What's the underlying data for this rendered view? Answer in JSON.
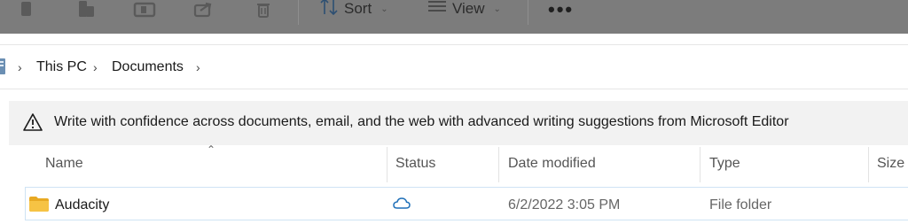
{
  "toolbar": {
    "sort_label": "Sort",
    "view_label": "View",
    "more_label": "•••"
  },
  "breadcrumb": {
    "items": [
      "This PC",
      "Documents"
    ]
  },
  "banner": {
    "text": "Write with confidence across documents, email, and the web with advanced writing suggestions from Microsoft Editor"
  },
  "columns": {
    "name": "Name",
    "status": "Status",
    "date_modified": "Date modified",
    "type": "Type",
    "size": "Size"
  },
  "rows": [
    {
      "name": "Audacity",
      "status_icon": "cloud-icon",
      "date_modified": "6/2/2022 3:05 PM",
      "type": "File folder"
    }
  ],
  "colors": {
    "toolbar_overlay": "#7c7c7c",
    "banner_bg": "#f2f2f2",
    "selection_border": "#cfe3f4",
    "cloud_blue": "#1e6fb8",
    "folder_yellow": "#f6c344"
  }
}
